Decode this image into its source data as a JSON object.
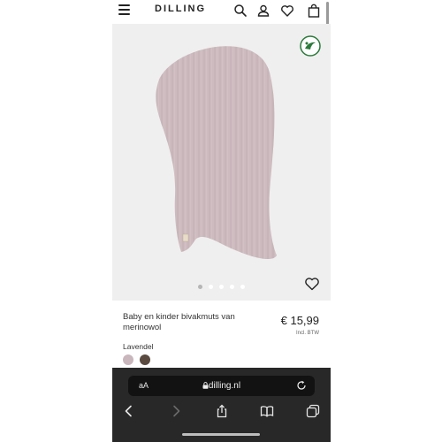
{
  "header": {
    "brand": "DILLING",
    "icons": [
      "menu-icon",
      "search-icon",
      "account-icon",
      "heart-icon",
      "bag-icon"
    ]
  },
  "gallery": {
    "badge_icon": "nordic-swan-ecolabel",
    "dot_count": 5,
    "active_dot": 1
  },
  "product": {
    "name": "Baby en kinder bivakmuts van merinowol",
    "price": "€ 15,99",
    "vat_note": "Incl. BTW",
    "color_label": "Lavendel",
    "swatches": [
      "#c9b6bd",
      "#5b4a3f"
    ]
  },
  "browser": {
    "text_size_label": "aA",
    "url": "dilling.nl",
    "toolbar_icons": [
      "back-icon",
      "forward-icon",
      "share-icon",
      "bookmarks-icon",
      "tabs-icon"
    ]
  },
  "colors": {
    "product": "#cdbbbf",
    "gallery_bg": "#efefef",
    "chrome_bg": "#282828"
  }
}
